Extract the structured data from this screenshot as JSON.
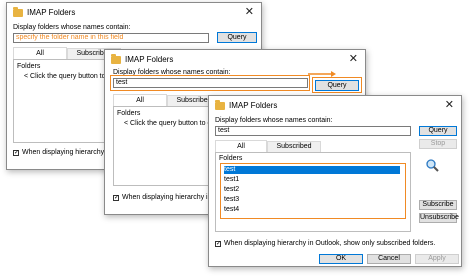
{
  "dialog1": {
    "title": "IMAP Folders",
    "filter_label": "Display folders whose names contain:",
    "filter_value": "specify the folder name in this field",
    "query_label": "Query",
    "tabs": [
      "All",
      "Subscribed"
    ],
    "folders_label": "Folders",
    "hint": "< Click the query button to downlo",
    "checkbox_label": "When displaying hierarchy in Outloo"
  },
  "dialog2": {
    "title": "IMAP Folders",
    "filter_label": "Display folders whose names contain:",
    "filter_value": "test",
    "query_label": "Query",
    "tabs": [
      "All",
      "Subscribed"
    ],
    "folders_label": "Folders",
    "hint": "< Click the query button to downlo",
    "checkbox_label": "When displaying hierarchy in Outlo"
  },
  "dialog3": {
    "title": "IMAP Folders",
    "filter_label": "Display folders whose names contain:",
    "filter_value": "test",
    "query_label": "Query",
    "stop_label": "Stop",
    "tabs": [
      "All",
      "Subscribed"
    ],
    "folders_label": "Folders",
    "folders": [
      "test",
      "test1",
      "test2",
      "test3",
      "test4"
    ],
    "selected_index": 0,
    "subscribe_label": "Subscribe",
    "unsubscribe_label": "Unsubscribe",
    "checkbox_label": "When displaying hierarchy in Outlook, show only subscribed folders.",
    "checkbox_checked": true,
    "ok_label": "OK",
    "cancel_label": "Cancel",
    "apply_label": "Apply"
  },
  "colors": {
    "highlight": "#f08a24",
    "selection": "#0078d7",
    "placeholder": "#f08a24"
  }
}
